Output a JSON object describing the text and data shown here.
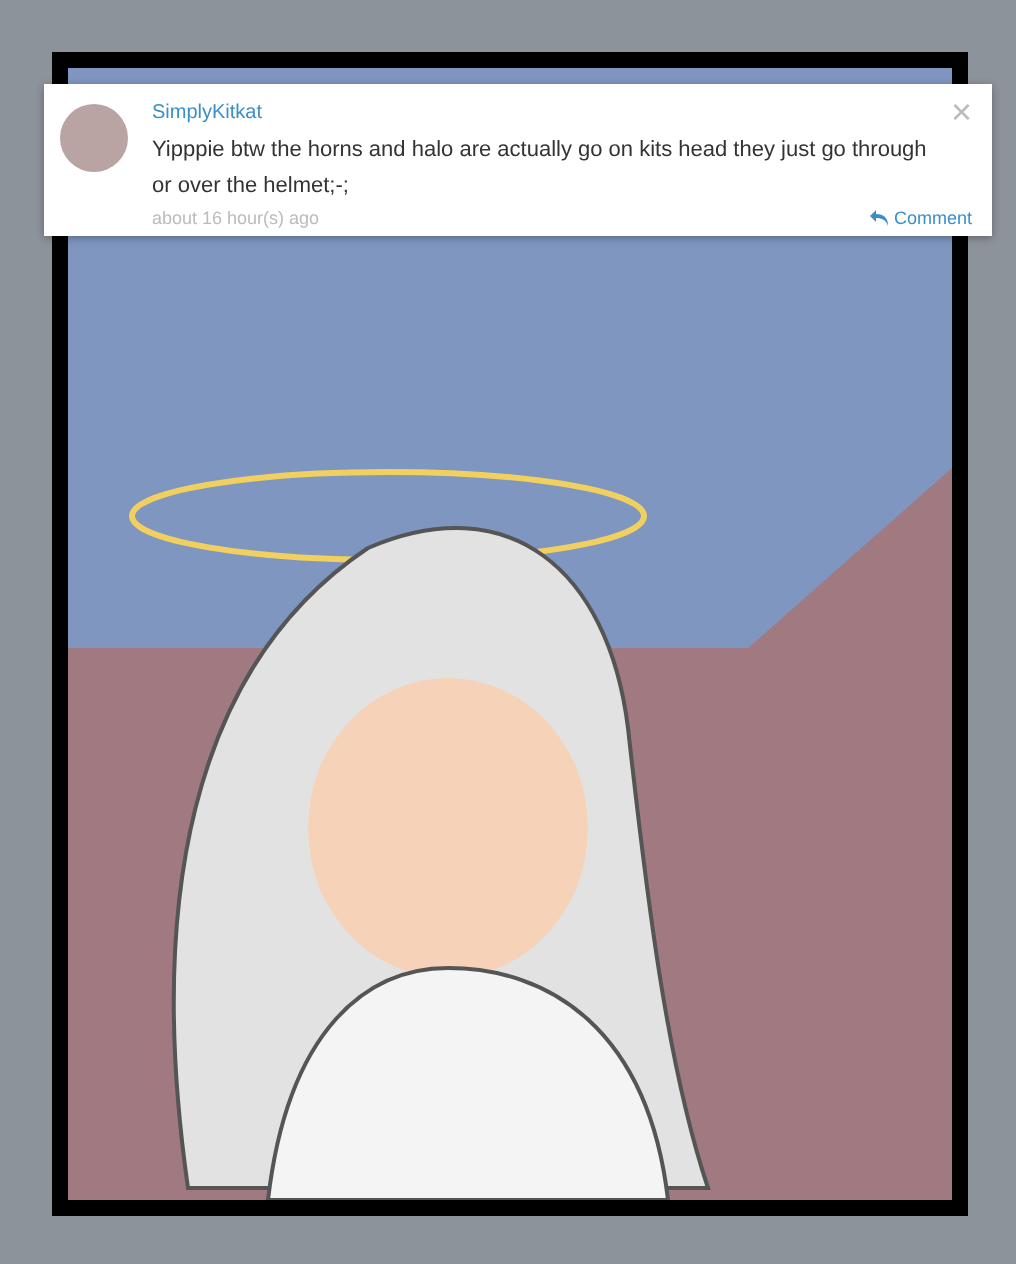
{
  "comment": {
    "author": "SimplyKitkat",
    "text": "Yipppie btw the horns and halo are actually go on kits head they just go through or over the helmet;-;",
    "time": "about 16 hour(s) ago",
    "close": "×",
    "reply": "Comment"
  }
}
